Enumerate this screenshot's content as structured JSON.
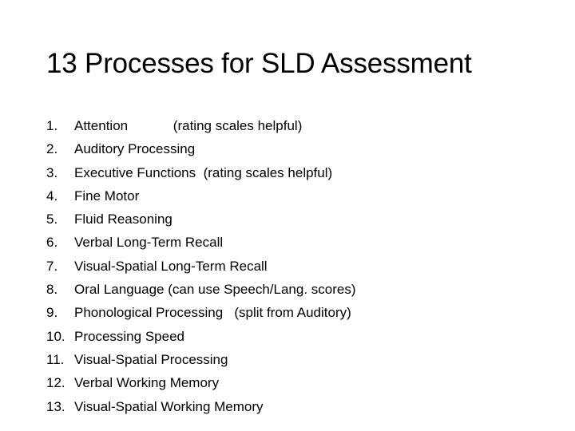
{
  "slide": {
    "title": "13 Processes for SLD Assessment",
    "items": [
      {
        "number": "1.",
        "text": "Attention",
        "note": "            (rating scales helpful)"
      },
      {
        "number": "2.",
        "text": "Auditory Processing",
        "note": ""
      },
      {
        "number": "3.",
        "text": "Executive Functions",
        "note": "  (rating scales helpful)"
      },
      {
        "number": "4.",
        "text": "Fine Motor",
        "note": ""
      },
      {
        "number": "5.",
        "text": "Fluid Reasoning",
        "note": ""
      },
      {
        "number": "6.",
        "text": "Verbal Long-Term Recall",
        "note": ""
      },
      {
        "number": "7.",
        "text": "Visual-Spatial Long-Term Recall",
        "note": ""
      },
      {
        "number": "8.",
        "text": "Oral Language",
        "note": " (can use Speech/Lang. scores)"
      },
      {
        "number": "9.",
        "text": "Phonological Processing",
        "note": "   (split from Auditory)"
      },
      {
        "number": "10.",
        "text": "Processing Speed",
        "note": ""
      },
      {
        "number": "11.",
        "text": "Visual-Spatial Processing",
        "note": ""
      },
      {
        "number": "12.",
        "text": "Verbal Working Memory",
        "note": ""
      },
      {
        "number": "13.",
        "text": "Visual-Spatial Working Memory",
        "note": ""
      }
    ]
  }
}
